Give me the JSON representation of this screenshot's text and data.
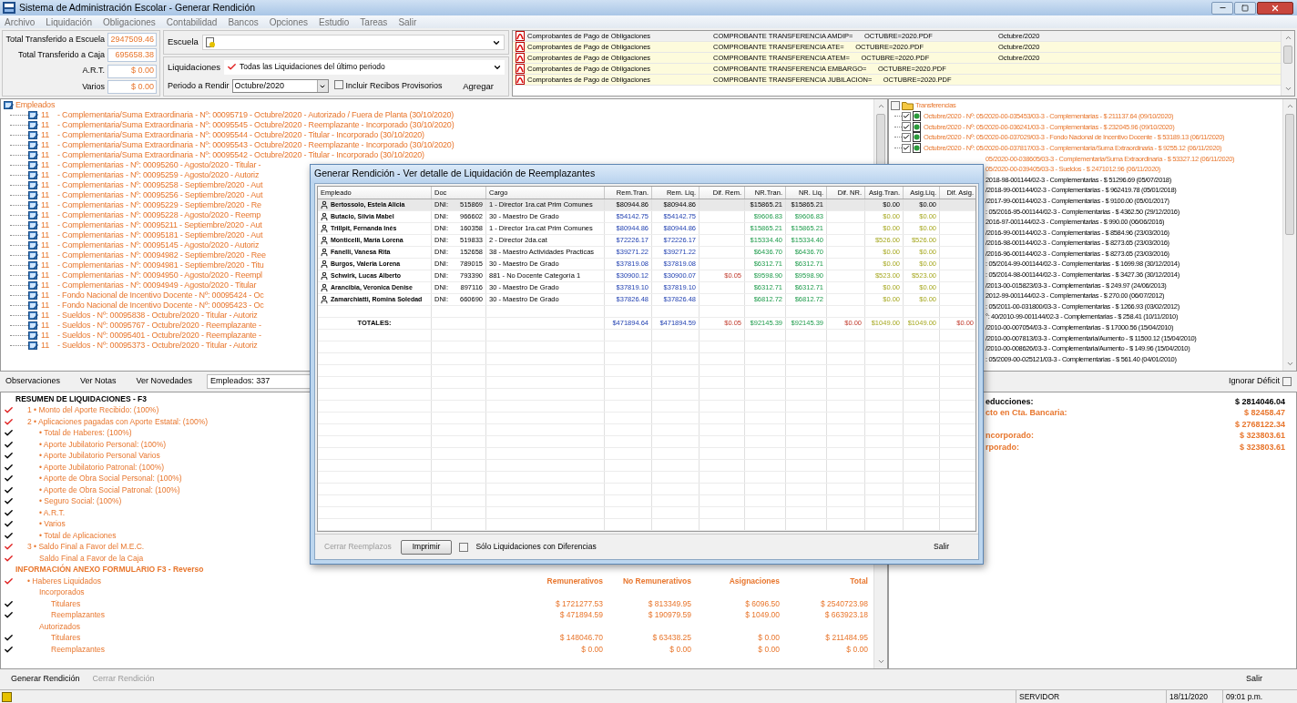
{
  "window": {
    "title": "Sistema de Administración Escolar - Generar Rendición"
  },
  "menu": [
    "Archivo",
    "Liquidación",
    "Obligaciones",
    "Contabilidad",
    "Bancos",
    "Opciones",
    "Estudio",
    "Tareas",
    "Salir"
  ],
  "totals": [
    {
      "label": "Total Transferido a Escuela",
      "value": "2947509.46"
    },
    {
      "label": "Total Transferido a Caja",
      "value": "695658.38"
    },
    {
      "label": "A.R.T.",
      "value": "$ 0.00"
    },
    {
      "label": "Varios",
      "value": "$ 0.00"
    }
  ],
  "escuela": {
    "label": "Escuela"
  },
  "liquidaciones": {
    "label": "Liquidaciones",
    "value": "Todas las Liquidaciones del último periodo"
  },
  "periodo": {
    "label": "Periodo a Rendir",
    "value": "Octubre/2020"
  },
  "incluir_provisorios": {
    "label": "Incluir Recibos Provisorios",
    "checked": false
  },
  "agregar": "Agregar",
  "documents": [
    {
      "type": "Comprobantes de Pago de Obligaciones",
      "file": "COMPROBANTE TRANSFERENCIA AMDIP=      OCTUBRE=2020.PDF",
      "period": "Octubre/2020",
      "selected": true
    },
    {
      "type": "Comprobantes de Pago de Obligaciones",
      "file": "COMPROBANTE TRANSFERENCIA ATE=      OCTUBRE=2020.PDF",
      "period": "Octubre/2020",
      "selected": false
    },
    {
      "type": "Comprobantes de Pago de Obligaciones",
      "file": "COMPROBANTE TRANSFERENCIA ATEM=      OCTUBRE=2020.PDF",
      "period": "Octubre/2020",
      "selected": false
    },
    {
      "type": "Comprobantes de Pago de Obligaciones",
      "file": "COMPROBANTE TRANSFERENCIA EMBARGO=      OCTUBRE=2020.PDF",
      "selected": false
    },
    {
      "type": "Comprobantes de Pago de Obligaciones",
      "file": "COMPROBANTE TRANSFERENCIA JUBILACION=      OCTUBRE=2020.PDF",
      "selected": false
    }
  ],
  "employees_tree": {
    "root": "Empleados",
    "children": [
      {
        "code": "11",
        "text": "- Complementaria/Suma Extraordinaria - Nº: 00095719 - Octubre/2020 - Autorizado / Fuera de Planta (30/10/2020)"
      },
      {
        "code": "11",
        "text": "- Complementaria/Suma Extraordinaria - Nº: 00095545 - Octubre/2020 - Reemplazante - Incorporado (30/10/2020)"
      },
      {
        "code": "11",
        "text": "- Complementaria/Suma Extraordinaria - Nº: 00095544 - Octubre/2020 - Titular - Incorporado (30/10/2020)"
      },
      {
        "code": "11",
        "text": "- Complementaria/Suma Extraordinaria - Nº: 00095543 - Octubre/2020 - Reemplazante - Incorporado (30/10/2020)"
      },
      {
        "code": "11",
        "text": "- Complementaria/Suma Extraordinaria - Nº: 00095542 - Octubre/2020 - Titular - Incorporado (30/10/2020)"
      },
      {
        "code": "11",
        "text": "- Complementarias - Nº: 00095260 - Agosto/2020 - Titular -"
      },
      {
        "code": "11",
        "text": "- Complementarias - Nº: 00095259 - Agosto/2020 - Autoriz"
      },
      {
        "code": "11",
        "text": "- Complementarias - Nº: 00095258 - Septiembre/2020 - Aut"
      },
      {
        "code": "11",
        "text": "- Complementarias - Nº: 00095256 - Septiembre/2020 - Aut"
      },
      {
        "code": "11",
        "text": "- Complementarias - Nº: 00095229 - Septiembre/2020 - Re"
      },
      {
        "code": "11",
        "text": "- Complementarias - Nº: 00095228 - Agosto/2020 - Reemp"
      },
      {
        "code": "11",
        "text": "- Complementarias - Nº: 00095211 - Septiembre/2020 - Aut"
      },
      {
        "code": "11",
        "text": "- Complementarias - Nº: 00095181 - Septiembre/2020 - Aut"
      },
      {
        "code": "11",
        "text": "- Complementarias - Nº: 00095145 - Agosto/2020 - Autoriz"
      },
      {
        "code": "11",
        "text": "- Complementarias - Nº: 00094982 - Septiembre/2020 - Ree"
      },
      {
        "code": "11",
        "text": "- Complementarias - Nº: 00094981 - Septiembre/2020 - Titu"
      },
      {
        "code": "11",
        "text": "- Complementarias - Nº: 00094950 - Agosto/2020 - Reempl"
      },
      {
        "code": "11",
        "text": "- Complementarias - Nº: 00094949 - Agosto/2020 - Titular"
      },
      {
        "code": "11",
        "text": "- Fondo Nacional de Incentivo Docente - Nº: 00095424 - Oc"
      },
      {
        "code": "11",
        "text": "- Fondo Nacional de Incentivo Docente - Nº: 00095423 - Oc"
      },
      {
        "code": "11",
        "text": "- Sueldos - Nº: 00095838 - Octubre/2020 - Titular - Autoriz"
      },
      {
        "code": "11",
        "text": "- Sueldos - Nº: 00095767 - Octubre/2020 - Reemplazante -"
      },
      {
        "code": "11",
        "text": "- Sueldos - Nº: 00095401 - Octubre/2020 - Reemplazante -"
      },
      {
        "code": "11",
        "text": "- Sueldos - Nº: 00095373 - Octubre/2020 - Titular - Autoriz"
      }
    ]
  },
  "transfers_tree": {
    "root": "Transferencias",
    "checked": false,
    "children": [
      {
        "text": "Octubre/2020 - Nº: 05/2020-00-035453/03-3 - Complementarias - $ 211137.64 (09/10/2020)",
        "checked": true,
        "highlighted": true
      },
      {
        "text": "Octubre/2020 - Nº: 05/2020-00-036241/03-3 - Complementarias - $ 232045.96 (09/10/2020)",
        "checked": true,
        "highlighted": true
      },
      {
        "text": "Octubre/2020 - Nº: 05/2020-00-037029/03-3 - Fondo Nacional de Incentivo Docente - $ 53189.13 (06/11/2020)",
        "checked": true,
        "highlighted": true
      },
      {
        "text": "Octubre/2020 - Nº: 05/2020-00-037817/03-3 - Complementaria/Suma Extraordinaria - $ 9255.12 (06/11/2020)",
        "checked": true,
        "highlighted": true
      },
      {
        "text": "05/2020-00-038605/03-3 - Complementaria/Suma Extraordinaria - $ 53327.12 (06/11/2020)",
        "covered": true,
        "highlighted": true
      },
      {
        "text": "05/2020-00-039405/03-3 - Sueldos - $ 2471012.96 (06/11/2020)",
        "covered": true,
        "highlighted": true
      },
      {
        "text": "2018-98-001144/02-3 - Complementarias - $ 51296.69 (05/07/2018)",
        "covered": true,
        "highlighted": false
      },
      {
        "text": "/2018-99-001144/02-3 - Complementarias - $ 962419.78 (05/01/2018)",
        "covered": true,
        "highlighted": false
      },
      {
        "text": "/2017-99-001144/02-3 - Complementarias - $ 9100.00 (05/01/2017)",
        "covered": true,
        "highlighted": false
      },
      {
        "text": ": 05/2016-95-001144/02-3 - Complementarias - $ 4362.50 (29/12/2016)",
        "covered": true,
        "highlighted": false
      },
      {
        "text": "2016-97-001144/02-3 - Complementarias - $ 990.00 (06/06/2016)",
        "covered": true,
        "highlighted": false
      },
      {
        "text": "/2016-99-001144/02-3 - Complementarias - $ 8584.96 (23/03/2016)",
        "covered": true,
        "highlighted": false
      },
      {
        "text": "/2016-98-001144/02-3 - Complementarias - $ 8273.65 (23/03/2016)",
        "covered": true,
        "highlighted": false
      },
      {
        "text": "/2016-96-001144/02-3 - Complementarias - $ 8273.65 (23/03/2016)",
        "covered": true,
        "highlighted": false
      },
      {
        "text": ": 05/2014-99-001144/02-3 - Complementarias - $ 1699.98 (30/12/2014)",
        "covered": true,
        "highlighted": false
      },
      {
        "text": ": 05/2014-98-001144/02-3 - Complementarias - $ 3427.36 (30/12/2014)",
        "covered": true,
        "highlighted": false
      },
      {
        "text": "/2013-00-015823/03-3 - Complementarias - $ 249.97 (24/06/2013)",
        "covered": true,
        "highlighted": false
      },
      {
        "text": "2012-99-001144/02-3 - Complementarias - $ 270.00 (06/07/2012)",
        "covered": true,
        "highlighted": false
      },
      {
        "text": ": 05/2011-00-031800/03-3 - Complementarias - $ 1266.93 (03/02/2012)",
        "covered": true,
        "highlighted": false
      },
      {
        "text": "°: 40/2010-99-001144/02-3 - Complementarias - $ 258.41 (10/11/2010)",
        "covered": true,
        "highlighted": false
      },
      {
        "text": "/2010-00-007054/03-3 - Complementarias - $ 17000.56 (15/04/2010)",
        "covered": true,
        "highlighted": false
      },
      {
        "text": "/2010-00-007813/03-3 - Complementaria/Aumento - $ 11500.12 (15/04/2010)",
        "covered": true,
        "highlighted": false
      },
      {
        "text": "/2010-00-008626/03-3 - Complementaria/Aumento - $ 149.96 (15/04/2010)",
        "covered": true,
        "highlighted": false
      },
      {
        "text": ": 05/2009-00-025121/03-3 - Complementarias - $ 561.40 (04/01/2010)",
        "covered": true,
        "highlighted": false
      }
    ]
  },
  "tabs": [
    "Observaciones",
    "Ver Notas",
    "Ver Novedades"
  ],
  "employees_count": "Empleados: 337",
  "ignorar_deficit": {
    "label": "Ignorar Déficit",
    "checked": false
  },
  "summary": [
    {
      "text": "RESUMEN DE LIQUIDACIONES - F3",
      "kind": "title",
      "children": [
        {
          "text": "1 • Monto del Aporte Recibido: (100%)",
          "color": "#e02020"
        },
        {
          "text": "2 • Aplicaciones pagadas con Aporte Estatal: (100%)",
          "color": "#e02020",
          "children": [
            {
              "text": "• Total de Haberes: (100%)",
              "color": "#000000"
            },
            {
              "text": "• Aporte Jubilatorio Personal: (100%)",
              "color": "#000000"
            },
            {
              "text": "• Aporte Jubilatorio Personal Varios",
              "color": "#000000"
            },
            {
              "text": "• Aporte Jubilatorio Patronal: (100%)",
              "color": "#000000"
            },
            {
              "text": "• Aporte de Obra Social Personal: (100%)",
              "color": "#000000"
            },
            {
              "text": "• Aporte de Obra Social Patronal: (100%)",
              "color": "#000000"
            },
            {
              "text": "• Seguro Social: (100%)",
              "color": "#000000"
            },
            {
              "text": "• A.R.T.",
              "color": "#000000"
            },
            {
              "text": "• Varios",
              "color": "#000000"
            },
            {
              "text": "• Total de Aplicaciones",
              "color": "#000000"
            }
          ]
        },
        {
          "text": "3 • Saldo Final a Favor del M.E.C.",
          "color": "#e02020",
          "children": [
            {
              "text": "Saldo Final a Favor de la Caja",
              "color": "#e02020"
            }
          ]
        }
      ]
    },
    {
      "text": "INFORMACIÓN ANEXO FORMULARIO F3 - Reverso",
      "kind": "section",
      "children": [
        {
          "text": "• Haberes Liquidados",
          "color": "#e02020",
          "headers": [
            "Remunerativos",
            "No Remunerativos",
            "Asignaciones",
            "Total"
          ],
          "children": [
            {
              "text": "Incorporados",
              "children": [
                {
                  "text": "Titulares",
                  "color": "#000000",
                  "values": [
                    "$ 1721277.53",
                    "$ 813349.95",
                    "$ 6096.50",
                    "$ 2540723.98"
                  ]
                },
                {
                  "text": "Reemplazantes",
                  "color": "#000000",
                  "values": [
                    "$ 471894.59",
                    "$ 190979.59",
                    "$ 1049.00",
                    "$ 663923.18"
                  ]
                }
              ]
            },
            {
              "text": "Autorizados",
              "children": [
                {
                  "text": "Titulares",
                  "color": "#000000",
                  "values": [
                    "$ 148046.70",
                    "$ 63438.25",
                    "$ 0.00",
                    "$ 211484.95"
                  ]
                },
                {
                  "text": "Reemplazantes",
                  "color": "#000000",
                  "values": [
                    "$ 0.00",
                    "$ 0.00",
                    "$ 0.00",
                    "$ 0.00"
                  ]
                }
              ]
            }
          ]
        }
      ]
    }
  ],
  "summary_right": [
    {
      "label": "educciones:",
      "value": "$ 2814046.04",
      "kind": "total"
    },
    {
      "label": "cto en Cta. Bancaria:",
      "value": "$ 82458.47",
      "kind": "detail"
    },
    {
      "value": "$ 2768122.34",
      "kind": "detail"
    },
    {
      "label": "ncorporado:",
      "value": "$ 323803.61",
      "kind": "detail"
    },
    {
      "label": "rporado:",
      "value": "$ 323803.61",
      "kind": "detail"
    }
  ],
  "actions": [
    {
      "label": "Generar Rendición",
      "disabled": false
    },
    {
      "label": "Cerrar Rendición",
      "disabled": true
    }
  ],
  "exit": "Salir",
  "status_bar": [
    "SERVIDOR",
    "18/11/2020",
    "09:01 p.m."
  ],
  "dialog": {
    "title": "Generar Rendición - Ver detalle de Liquidación de Reemplazantes",
    "columns": [
      "Empleado",
      "Doc",
      "Cargo",
      "Rem.Tran.",
      "Rem. Liq.",
      "Dif. Rem.",
      "NR.Tran.",
      "NR. Liq.",
      "Dif. NR.",
      "Asig.Tran.",
      "Asig.Liq.",
      "Dif. Asig."
    ],
    "rows": [
      {
        "name": "Bertossolo, Estela Alicia",
        "doc_type": "DNI:",
        "doc": "515869",
        "cargo": "1 - Director 1ra.cat Prim Comunes",
        "values": {
          "rem_tran": "$80944.86",
          "rem_liq": "$80944.86",
          "nr_tran": "$15865.21",
          "nr_liq": "$15865.21",
          "asig_tran": "$0.00",
          "asig_liq": "$0.00"
        },
        "selected": true
      },
      {
        "name": "Butacio, Silvia Mabel",
        "doc_type": "DNI:",
        "doc": "966602",
        "cargo": "30 - Maestro De Grado",
        "values": {
          "rem_tran": "$54142.75",
          "rem_liq": "$54142.75",
          "nr_tran": "$9606.83",
          "nr_liq": "$9606.83",
          "asig_tran": "$0.00",
          "asig_liq": "$0.00"
        },
        "selected": false
      },
      {
        "name": "Trillpit, Fernanda Inés",
        "doc_type": "DNI:",
        "doc": "160358",
        "cargo": "1 - Director 1ra.cat Prim Comunes",
        "values": {
          "rem_tran": "$80944.86",
          "rem_liq": "$80944.86",
          "nr_tran": "$15865.21",
          "nr_liq": "$15865.21",
          "asig_tran": "$0.00",
          "asig_liq": "$0.00"
        },
        "selected": false
      },
      {
        "name": "Monticelli, María Lorena",
        "doc_type": "DNI:",
        "doc": "519833",
        "cargo": "2 - Director 2da.cat",
        "values": {
          "rem_tran": "$72226.17",
          "rem_liq": "$72226.17",
          "nr_tran": "$15334.40",
          "nr_liq": "$15334.40",
          "asig_tran": "$526.00",
          "asig_liq": "$526.00"
        },
        "selected": false
      },
      {
        "name": "Fanelli, Vanesa Rita",
        "doc_type": "DNI:",
        "doc": "152658",
        "cargo": "38 - Maestro Actividades Practicas",
        "values": {
          "rem_tran": "$39271.22",
          "rem_liq": "$39271.22",
          "nr_tran": "$6436.70",
          "nr_liq": "$6436.70",
          "asig_tran": "$0.00",
          "asig_liq": "$0.00"
        },
        "selected": false
      },
      {
        "name": "Burgos, Valeria Lorena",
        "doc_type": "DNI:",
        "doc": "789015",
        "cargo": "30 - Maestro De Grado",
        "values": {
          "rem_tran": "$37819.08",
          "rem_liq": "$37819.08",
          "nr_tran": "$6312.71",
          "nr_liq": "$6312.71",
          "asig_tran": "$0.00",
          "asig_liq": "$0.00"
        },
        "selected": false
      },
      {
        "name": "Schwirk, Lucas Alberto",
        "doc_type": "DNI:",
        "doc": "793390",
        "cargo": "881 - No Docente Categoría 1",
        "values": {
          "rem_tran": "$30900.12",
          "rem_liq": "$30900.07",
          "dif_rem": "$0.05",
          "nr_tran": "$9598.90",
          "nr_liq": "$9598.90",
          "asig_tran": "$523.00",
          "asig_liq": "$523.00"
        },
        "selected": false
      },
      {
        "name": "Arancibia, Veronica Denise",
        "doc_type": "DNI:",
        "doc": "897116",
        "cargo": "30 - Maestro De Grado",
        "values": {
          "rem_tran": "$37819.10",
          "rem_liq": "$37819.10",
          "nr_tran": "$6312.71",
          "nr_liq": "$6312.71",
          "asig_tran": "$0.00",
          "asig_liq": "$0.00"
        },
        "selected": false
      },
      {
        "name": "Zamarchiatti, Romina Soledad",
        "doc_type": "DNI:",
        "doc": "660690",
        "cargo": "30 - Maestro De Grado",
        "values": {
          "rem_tran": "$37826.48",
          "rem_liq": "$37826.48",
          "nr_tran": "$6812.72",
          "nr_liq": "$6812.72",
          "asig_tran": "$0.00",
          "asig_liq": "$0.00"
        },
        "selected": false
      }
    ],
    "totals": {
      "label": "TOTALES:",
      "values": {
        "rem_tran": "$471894.64",
        "rem_liq": "$471894.59",
        "dif_rem": "$0.05",
        "nr_tran": "$92145.39",
        "nr_liq": "$92145.39",
        "dif_nr": "$0.00",
        "asig_tran": "$1049.00",
        "asig_liq": "$1049.00",
        "dif_asig": "$0.00"
      }
    },
    "cerrar": {
      "label": "Cerrar Reemplazos",
      "disabled": true
    },
    "imprimir": "Imprimir",
    "only_diff": {
      "label": "Sólo Liquidaciones con Diferencias",
      "checked": false
    },
    "salir": "Salir"
  }
}
